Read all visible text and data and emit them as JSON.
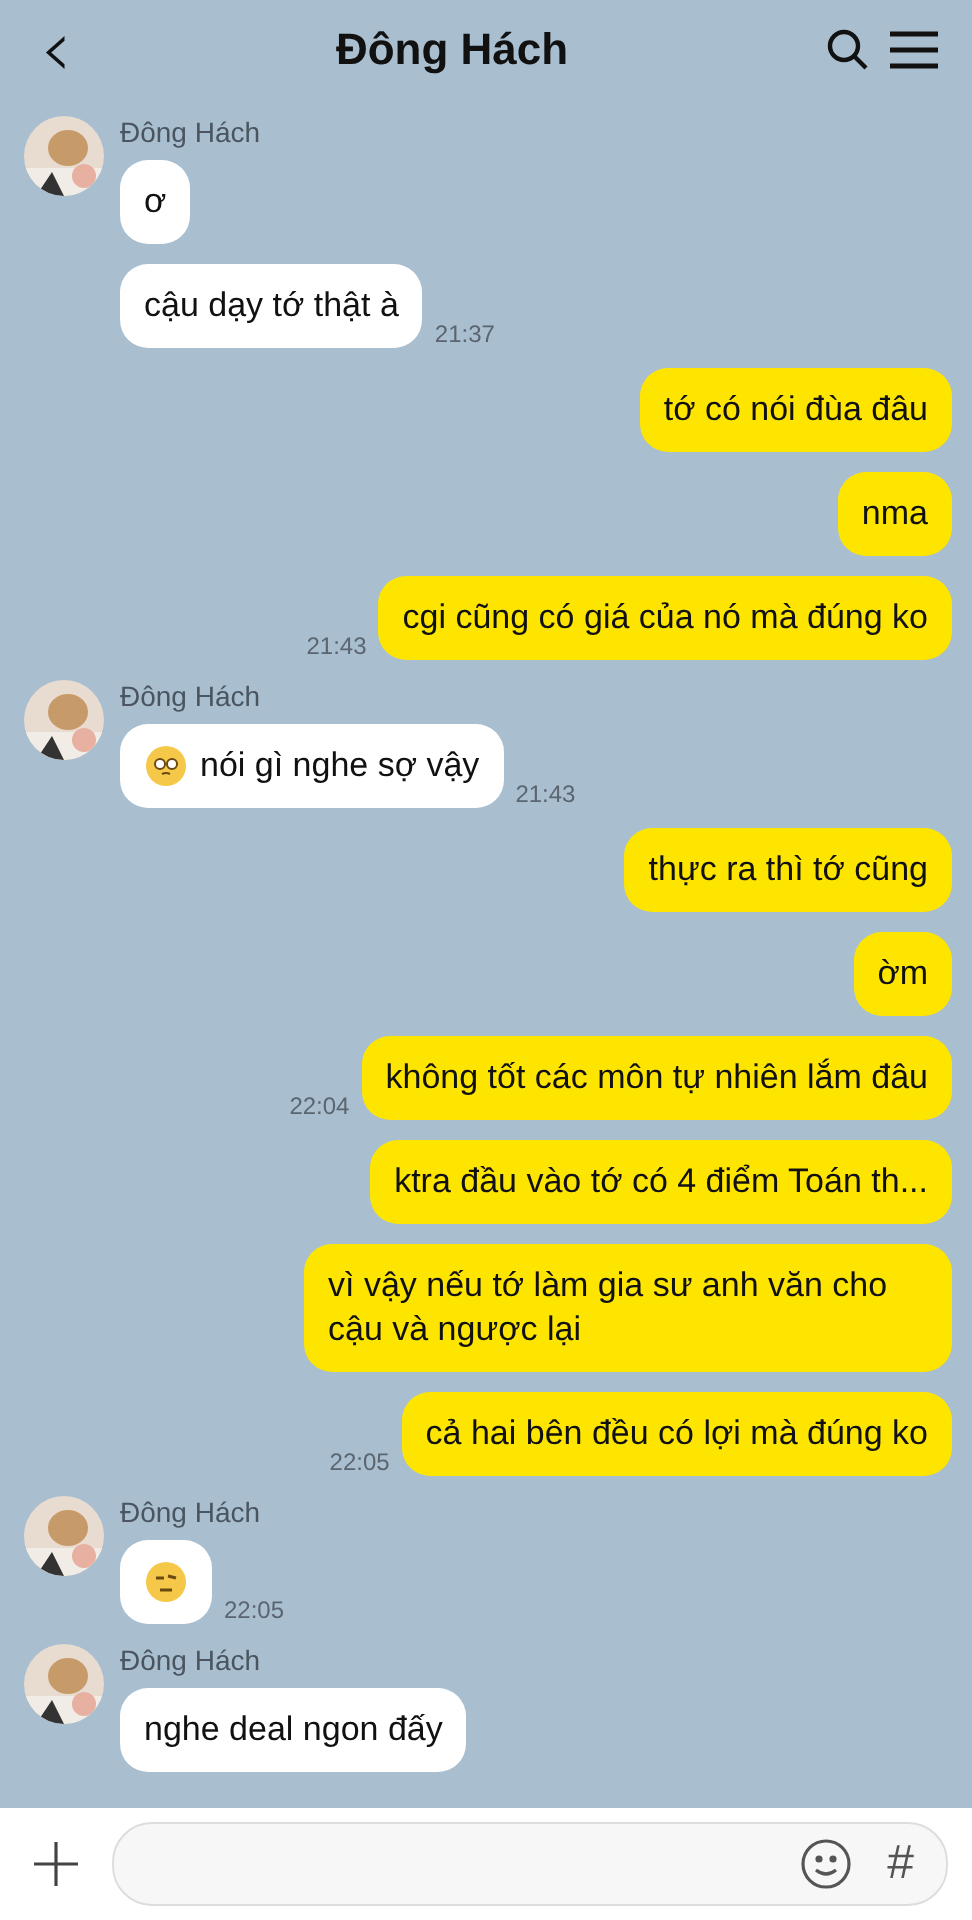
{
  "header": {
    "back": "‹",
    "title": "Đông Hách"
  },
  "groups": [
    {
      "outgoing": false,
      "name": "Đông Hách",
      "time": "21:37",
      "bubbles": [
        {
          "kind": "text",
          "text": "ơ"
        },
        {
          "kind": "text",
          "text": "cậu dạy tớ thật à"
        }
      ]
    },
    {
      "outgoing": true,
      "time": "21:43",
      "bubbles": [
        {
          "kind": "text",
          "text": "tớ có nói đùa đâu"
        },
        {
          "kind": "text",
          "text": "nma"
        },
        {
          "kind": "text",
          "text": "cgi cũng có giá của nó mà đúng ko"
        }
      ]
    },
    {
      "outgoing": false,
      "name": "Đông Hách",
      "time": "21:43",
      "bubbles": [
        {
          "kind": "icon_text",
          "text": "nói gì nghe sợ vậy"
        }
      ]
    },
    {
      "outgoing": true,
      "time": "22:04",
      "bubbles": [
        {
          "kind": "text",
          "text": "thực ra thì tớ cũng"
        },
        {
          "kind": "text",
          "text": "ờm"
        },
        {
          "kind": "text",
          "text": "không tốt các môn tự nhiên lắm đâu"
        }
      ]
    },
    {
      "outgoing": true,
      "time": "22:05",
      "bubbles": [
        {
          "kind": "text",
          "text": "ktra đầu vào tớ có 4 điểm Toán th..."
        },
        {
          "kind": "text",
          "text": "vì vậy nếu tớ làm gia sư anh văn cho cậu và ngược lại"
        },
        {
          "kind": "text",
          "text": "cả hai bên đều có lợi mà đúng ko"
        }
      ]
    },
    {
      "outgoing": false,
      "name": "Đông Hách",
      "time": "22:05",
      "bubbles": [
        {
          "kind": "icon"
        }
      ]
    },
    {
      "outgoing": false,
      "name": "Đông Hách",
      "bubbles": [
        {
          "kind": "text",
          "text": "nghe deal ngon đấy"
        }
      ]
    }
  ],
  "composer": {
    "hash": "#"
  }
}
